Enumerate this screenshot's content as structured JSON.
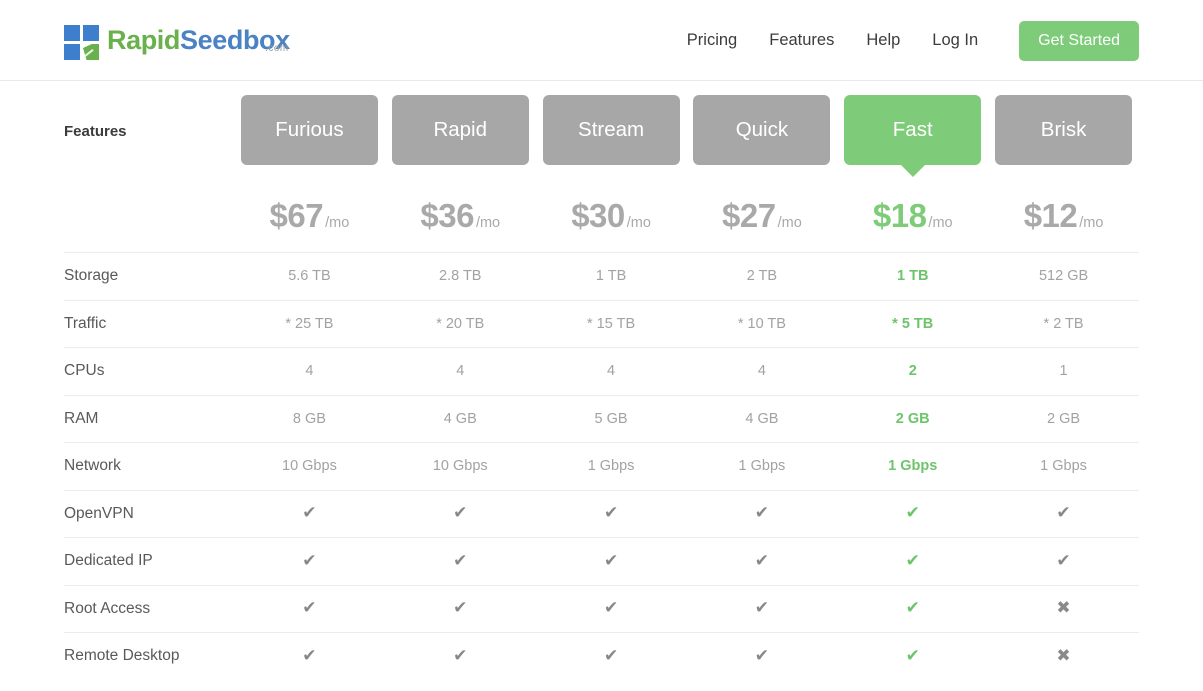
{
  "header": {
    "logo": {
      "mark_icon": "rapidseedbox-squares-leaf-icon",
      "part1": "Rapid",
      "part2": "Seedbox",
      "tld": ".com"
    },
    "nav": [
      {
        "label": "Pricing"
      },
      {
        "label": "Features"
      },
      {
        "label": "Help"
      },
      {
        "label": "Log In"
      }
    ],
    "cta_label": "Get Started"
  },
  "table": {
    "features_heading": "Features",
    "plans": [
      {
        "name": "Furious",
        "price": "$67",
        "per": "/mo",
        "active": false
      },
      {
        "name": "Rapid",
        "price": "$36",
        "per": "/mo",
        "active": false
      },
      {
        "name": "Stream",
        "price": "$30",
        "per": "/mo",
        "active": false
      },
      {
        "name": "Quick",
        "price": "$27",
        "per": "/mo",
        "active": false
      },
      {
        "name": "Fast",
        "price": "$18",
        "per": "/mo",
        "active": true
      },
      {
        "name": "Brisk",
        "price": "$12",
        "per": "/mo",
        "active": false
      }
    ],
    "rows": [
      {
        "label": "Storage",
        "type": "text",
        "values": [
          "5.6 TB",
          "2.8 TB",
          "1 TB",
          "2 TB",
          "1 TB",
          "512 GB"
        ]
      },
      {
        "label": "Traffic",
        "type": "text",
        "values": [
          "* 25 TB",
          "* 20 TB",
          "* 15 TB",
          "* 10 TB",
          "* 5 TB",
          "* 2 TB"
        ]
      },
      {
        "label": "CPUs",
        "type": "text",
        "values": [
          "4",
          "4",
          "4",
          "4",
          "2",
          "1"
        ]
      },
      {
        "label": "RAM",
        "type": "text",
        "values": [
          "8 GB",
          "4 GB",
          "5 GB",
          "4 GB",
          "2 GB",
          "2 GB"
        ]
      },
      {
        "label": "Network",
        "type": "text",
        "values": [
          "10 Gbps",
          "10 Gbps",
          "1 Gbps",
          "1 Gbps",
          "1 Gbps",
          "1 Gbps"
        ]
      },
      {
        "label": "OpenVPN",
        "type": "mark",
        "values": [
          "yes",
          "yes",
          "yes",
          "yes",
          "yes",
          "yes"
        ]
      },
      {
        "label": "Dedicated IP",
        "type": "mark",
        "values": [
          "yes",
          "yes",
          "yes",
          "yes",
          "yes",
          "yes"
        ]
      },
      {
        "label": "Root Access",
        "type": "mark",
        "values": [
          "yes",
          "yes",
          "yes",
          "yes",
          "yes",
          "no"
        ]
      },
      {
        "label": "Remote Desktop",
        "type": "mark",
        "values": [
          "yes",
          "yes",
          "yes",
          "yes",
          "yes",
          "no"
        ]
      }
    ],
    "highlight_column_index": 4,
    "marks": {
      "yes_glyph": "✔",
      "no_glyph": "✖"
    }
  },
  "colors": {
    "brand_green": "#7ecb79",
    "brand_blue": "#4a82c4",
    "tab_gray": "#a7a7a7",
    "value_gray": "#a2a2a2"
  }
}
